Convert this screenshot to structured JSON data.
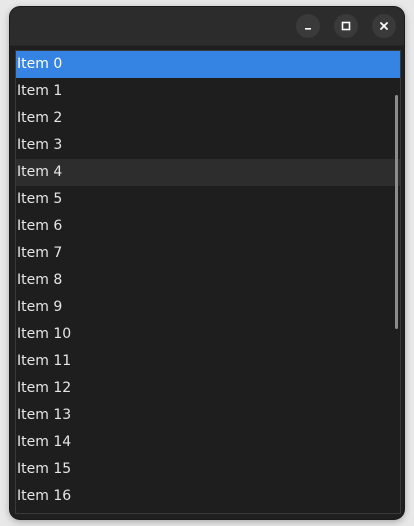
{
  "window": {
    "controls": {
      "minimize": "minimize-icon",
      "maximize": "maximize-icon",
      "close": "close-icon"
    }
  },
  "list": {
    "selected_index": 0,
    "hovered_index": 4,
    "items": [
      "Item 0",
      "Item 1",
      "Item 2",
      "Item 3",
      "Item 4",
      "Item 5",
      "Item 6",
      "Item 7",
      "Item 8",
      "Item 9",
      "Item 10",
      "Item 11",
      "Item 12",
      "Item 13",
      "Item 14",
      "Item 15",
      "Item 16"
    ]
  },
  "colors": {
    "selection": "#3584e4",
    "background": "#1e1e1e",
    "titlebar": "#2c2c2c"
  }
}
